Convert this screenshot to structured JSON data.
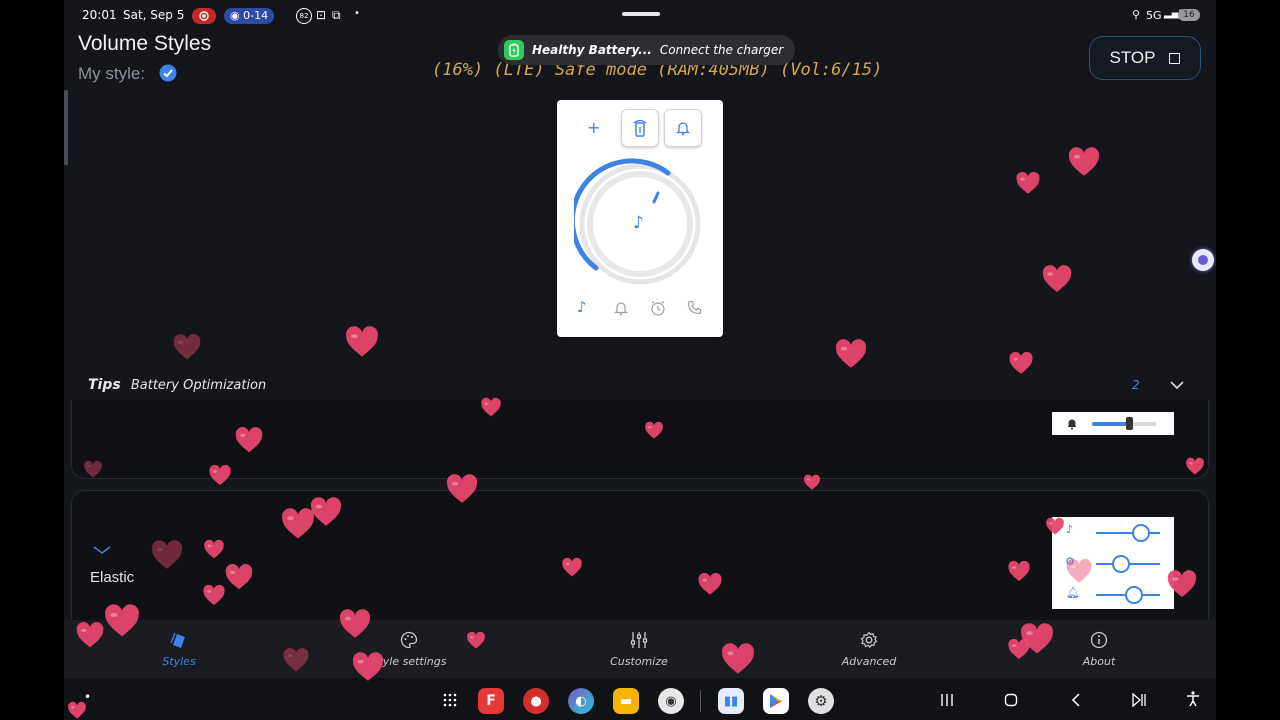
{
  "status_bar": {
    "time": "20:01",
    "date": "Sat, Sep 5",
    "badge_text": "0-14",
    "small_badge": "82",
    "signal": "5G",
    "battery": "16"
  },
  "header": {
    "title": "Volume Styles",
    "my_style_label": "My style:",
    "stop_label": "STOP"
  },
  "toast": {
    "title": "Healthy Battery...",
    "message": "Connect the charger"
  },
  "overlay": {
    "info_text": "(16%) (LTE) Safe mode (RAM:405MB) (Vol:6/15)"
  },
  "tips": {
    "label": "Tips",
    "text": "Battery Optimization",
    "count": "2"
  },
  "style_card": {
    "name": "Elastic"
  },
  "nav": {
    "items": [
      {
        "label": "Styles"
      },
      {
        "label": "Style settings"
      },
      {
        "label": "Customize"
      },
      {
        "label": "Advanced"
      },
      {
        "label": "About"
      }
    ]
  },
  "colors": {
    "accent": "#3d82e6",
    "background": "#14161b",
    "heart": "#e8466e",
    "overlay_text": "#d3a84a"
  },
  "icons": {
    "my_style": "check-badge-icon",
    "volume_panel": [
      "plus-icon",
      "ring-settings-icon",
      "bell-icon",
      "music-note-icon",
      "alarm-icon",
      "phone-icon"
    ]
  }
}
